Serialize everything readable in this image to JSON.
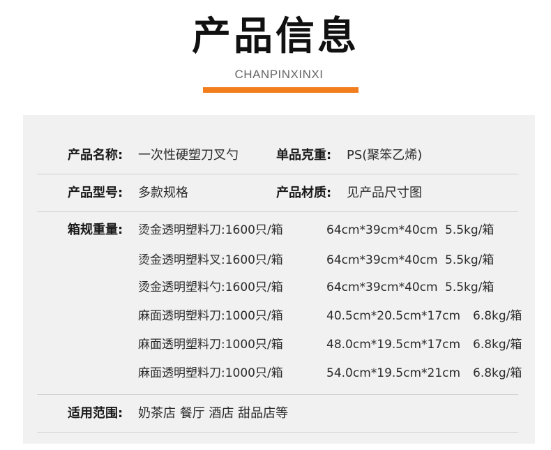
{
  "header": {
    "title": "产品信息",
    "subtitle": "CHANPINXINXI",
    "accent_color": "#f17d1c"
  },
  "info": {
    "name_label": "产品名称:",
    "name_value": "一次性硬塑刀叉勺",
    "weight_label": "单品克重:",
    "weight_value": "PS(聚笨乙烯)",
    "model_label": "产品型号:",
    "model_value": "多款规格",
    "material_label": "产品材质:",
    "material_value": "见产品尺寸图",
    "packing_label": "箱规重量:",
    "packing_rows": [
      {
        "item": "烫金透明塑料刀:1600只/箱",
        "size": "64cm*39cm*40cm",
        "weight": "5.5kg/箱"
      },
      {
        "item": "烫金透明塑料叉:1600只/箱",
        "size": "64cm*39cm*40cm",
        "weight": "5.5kg/箱"
      },
      {
        "item": "烫金透明塑料勺:1600只/箱",
        "size": "64cm*39cm*40cm",
        "weight": "5.5kg/箱"
      },
      {
        "item": "麻面透明塑料刀:1000只/箱",
        "size": "40.5cm*20.5cm*17cm",
        "weight": "6.8kg/箱"
      },
      {
        "item": "麻面透明塑料刀:1000只/箱",
        "size": "48.0cm*19.5cm*17cm",
        "weight": "6.8kg/箱"
      },
      {
        "item": "麻面透明塑料刀:1000只/箱",
        "size": "54.0cm*19.5cm*21cm",
        "weight": "6.8kg/箱"
      }
    ],
    "scope_label": "适用范围:",
    "scope_value": "奶茶店 餐厅 酒店 甜品店等"
  }
}
